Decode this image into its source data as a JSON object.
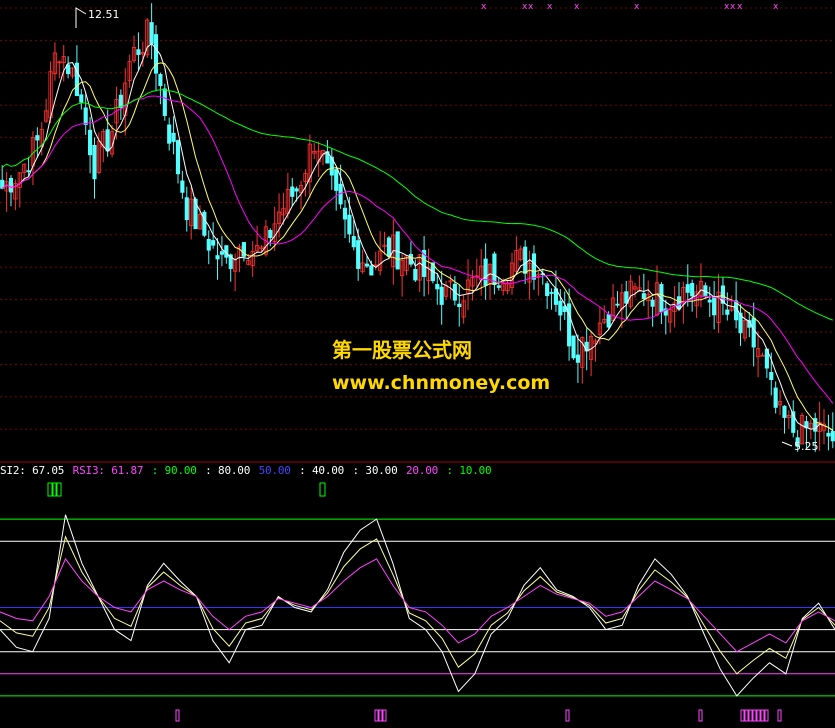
{
  "chart_data": [
    {
      "type": "candlestick",
      "price_high_label": "12.51",
      "price_low_label": "5.25",
      "price_range": [
        5.25,
        12.51
      ],
      "ma_lines": [
        {
          "color": "#ffffff"
        },
        {
          "color": "#ffff66"
        },
        {
          "color": "#ff00ff"
        },
        {
          "color": "#00ff00"
        }
      ],
      "grid": "dashed-red-horizontal",
      "trend_closes": [
        9.6,
        9.9,
        10.4,
        12.0,
        11.4,
        10.0,
        10.6,
        11.8,
        12.2,
        10.6,
        9.3,
        8.8,
        8.3,
        8.7,
        8.5,
        9.2,
        9.6,
        10.5,
        9.4,
        8.6,
        8.3,
        8.6,
        8.4,
        8.1,
        7.8,
        7.9,
        8.1,
        8.2,
        8.4,
        8.3,
        7.8,
        6.9,
        7.2,
        7.6,
        7.8,
        7.9,
        7.7,
        7.9,
        7.8,
        7.6,
        7.2,
        6.9,
        5.8,
        5.5,
        5.6,
        5.4
      ],
      "markers_top": [
        "x",
        "x",
        "x",
        "x",
        "x",
        "x",
        "x",
        "x",
        "x",
        "x",
        "x",
        "x"
      ]
    },
    {
      "type": "line",
      "indicator": "RSI",
      "series": [
        {
          "name": "SI2",
          "color": "#ffff99"
        },
        {
          "name": "RSI3",
          "color": "#ff44ff"
        },
        {
          "color": "#ffffff"
        }
      ],
      "reference_levels": [
        90,
        80,
        50,
        40,
        30,
        20,
        10
      ],
      "rsi1": [
        40,
        32,
        30,
        45,
        92,
        70,
        55,
        40,
        35,
        60,
        70,
        62,
        55,
        35,
        25,
        40,
        42,
        55,
        50,
        48,
        58,
        75,
        85,
        90,
        70,
        45,
        40,
        30,
        12,
        20,
        38,
        45,
        60,
        68,
        58,
        55,
        50,
        40,
        42,
        60,
        72,
        65,
        55,
        38,
        22,
        10,
        18,
        25,
        20,
        45,
        52,
        40
      ],
      "rsi2": [
        48,
        45,
        44,
        55,
        72,
        62,
        55,
        50,
        48,
        58,
        62,
        58,
        55,
        46,
        40,
        46,
        48,
        54,
        52,
        50,
        55,
        62,
        68,
        72,
        60,
        50,
        48,
        42,
        34,
        38,
        46,
        50,
        55,
        60,
        56,
        54,
        52,
        46,
        48,
        55,
        62,
        58,
        54,
        46,
        38,
        30,
        34,
        38,
        34,
        44,
        48,
        44
      ]
    }
  ],
  "legend": {
    "si2": "SI2: 67.05",
    "rsi3": "RSI3: 61.87",
    "l90": ": 90.00",
    "l80": ": 80.00",
    "l50": "50.00",
    "l40": ": 40.00",
    "l30": ": 30.00",
    "l20": "20.00",
    "l10": ": 10.00"
  },
  "watermark": {
    "line1": "第一股票公式网",
    "line2": "www.chnmoney.com"
  }
}
